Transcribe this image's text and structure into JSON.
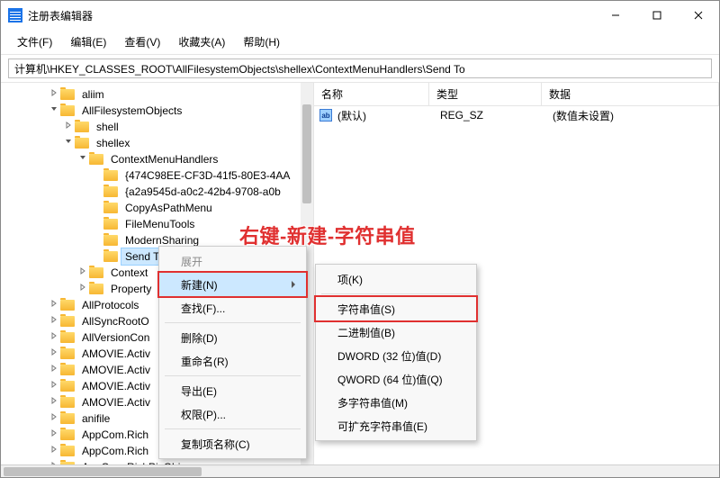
{
  "window": {
    "title": "注册表编辑器"
  },
  "menubar": {
    "file": "文件(F)",
    "edit": "编辑(E)",
    "view": "查看(V)",
    "favorites": "收藏夹(A)",
    "help": "帮助(H)"
  },
  "address": {
    "value": "计算机\\HKEY_CLASSES_ROOT\\AllFilesystemObjects\\shellex\\ContextMenuHandlers\\Send To"
  },
  "tree": {
    "nodes": [
      {
        "indent": 3,
        "exp": ">",
        "label": "aliim"
      },
      {
        "indent": 3,
        "exp": "v",
        "label": "AllFilesystemObjects"
      },
      {
        "indent": 4,
        "exp": ">",
        "label": "shell"
      },
      {
        "indent": 4,
        "exp": "v",
        "label": "shellex"
      },
      {
        "indent": 5,
        "exp": "v",
        "label": "ContextMenuHandlers"
      },
      {
        "indent": 6,
        "exp": "",
        "label": "{474C98EE-CF3D-41f5-80E3-4AA"
      },
      {
        "indent": 6,
        "exp": "",
        "label": "{a2a9545d-a0c2-42b4-9708-a0b"
      },
      {
        "indent": 6,
        "exp": "",
        "label": "CopyAsPathMenu"
      },
      {
        "indent": 6,
        "exp": "",
        "label": "FileMenuTools"
      },
      {
        "indent": 6,
        "exp": "",
        "label": "ModernSharing"
      },
      {
        "indent": 6,
        "exp": "",
        "label": "Send To",
        "selected": true,
        "boxed": true
      },
      {
        "indent": 5,
        "exp": ">",
        "label": "Context"
      },
      {
        "indent": 5,
        "exp": ">",
        "label": "Property"
      },
      {
        "indent": 3,
        "exp": ">",
        "label": "AllProtocols"
      },
      {
        "indent": 3,
        "exp": ">",
        "label": "AllSyncRootO"
      },
      {
        "indent": 3,
        "exp": ">",
        "label": "AllVersionCon"
      },
      {
        "indent": 3,
        "exp": ">",
        "label": "AMOVIE.Activ"
      },
      {
        "indent": 3,
        "exp": ">",
        "label": "AMOVIE.Activ"
      },
      {
        "indent": 3,
        "exp": ">",
        "label": "AMOVIE.Activ"
      },
      {
        "indent": 3,
        "exp": ">",
        "label": "AMOVIE.Activ"
      },
      {
        "indent": 3,
        "exp": ">",
        "label": "anifile"
      },
      {
        "indent": 3,
        "exp": ">",
        "label": "AppCom.Rich"
      },
      {
        "indent": 3,
        "exp": ">",
        "label": "AppCom.Rich"
      },
      {
        "indent": 3,
        "exp": ">",
        "label": "AppCom.RichPicObj"
      }
    ]
  },
  "list": {
    "headers": {
      "name": "名称",
      "type": "类型",
      "data": "数据"
    },
    "rows": [
      {
        "name": "(默认)",
        "type": "REG_SZ",
        "data": "(数值未设置)",
        "icon_text": "ab"
      }
    ]
  },
  "context_menu_1": {
    "expand": "展开",
    "new": "新建(N)",
    "find": "查找(F)...",
    "delete": "删除(D)",
    "rename": "重命名(R)",
    "export": "导出(E)",
    "permissions": "权限(P)...",
    "copy_key_name": "复制项名称(C)"
  },
  "context_menu_2": {
    "key": "项(K)",
    "string": "字符串值(S)",
    "binary": "二进制值(B)",
    "dword": "DWORD (32 位)值(D)",
    "qword": "QWORD (64 位)值(Q)",
    "multistring": "多字符串值(M)",
    "expandstring": "可扩充字符串值(E)"
  },
  "instruction_text": "右键-新建-字符串值"
}
